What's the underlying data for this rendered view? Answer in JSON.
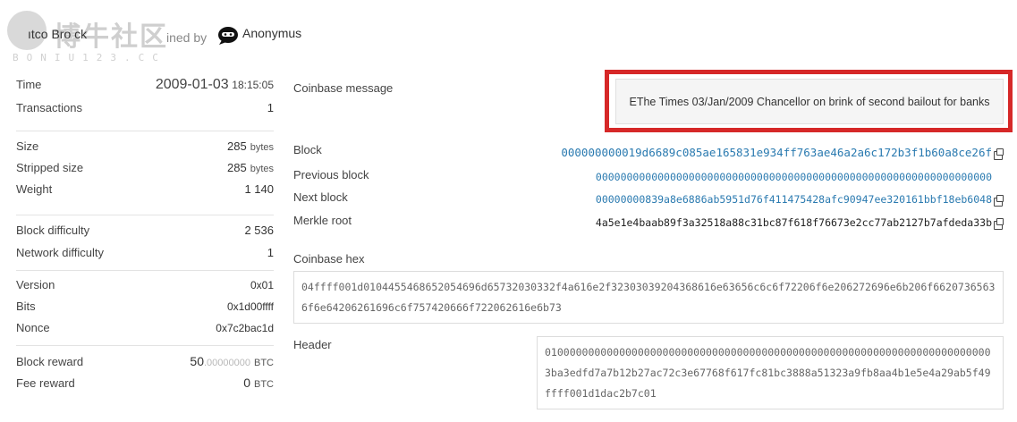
{
  "header": {
    "watermark_title": "博牛社区",
    "watermark_sub": "BONIU123.CC",
    "title_prefix": "ıtco Bro ck",
    "mined_by": "ined by",
    "miner": "Anonymus"
  },
  "left": {
    "group1": [
      {
        "label": "Time",
        "date": "2009-01-03",
        "time": "18:15:05"
      },
      {
        "label": "Transactions",
        "value": "1"
      }
    ],
    "group2": [
      {
        "label": "Size",
        "value": "285",
        "unit": "bytes"
      },
      {
        "label": "Stripped size",
        "value": "285",
        "unit": "bytes"
      },
      {
        "label": "Weight",
        "value": "1 140"
      }
    ],
    "group3": [
      {
        "label": "Block difficulty",
        "value": "2 536"
      },
      {
        "label": "Network difficulty",
        "value": "1"
      }
    ],
    "group4": [
      {
        "label": "Version",
        "value": "0x01"
      },
      {
        "label": "Bits",
        "value": "0x1d00ffff"
      },
      {
        "label": "Nonce",
        "value": "0x7c2bac1d"
      }
    ],
    "group5": [
      {
        "label": "Block reward",
        "value_int": "50",
        "value_dec": ".00000000",
        "unit": "BTC"
      },
      {
        "label": "Fee reward",
        "value": "0",
        "unit": "BTC"
      }
    ]
  },
  "right": {
    "coinbase_message_label": "Coinbase message",
    "coinbase_message": "EThe Times 03/Jan/2009 Chancellor on brink of second bailout for banks",
    "block_label": "Block",
    "block_hash": "000000000019d6689c085ae165831e934ff763ae46a2a6c172b3f1b60a8ce26f",
    "previous_label": "Previous block",
    "previous_hash": "0000000000000000000000000000000000000000000000000000000000000000",
    "next_label": "Next block",
    "next_hash": "00000000839a8e6886ab5951d76f411475428afc90947ee320161bbf18eb6048",
    "merkle_label": "Merkle root",
    "merkle_root": "4a5e1e4baab89f3a32518a88c31bc87f618f76673e2cc77ab2127b7afdeda33b",
    "coinbase_hex_label": "Coinbase hex",
    "coinbase_hex": "04ffff001d0104455468652054696d65732030332f4a616e2f32303039204368616e63656c6c6f72206f6e206272696e6b206f66207365636f6e64206261696c6f757420666f722062616e6b73",
    "header_label": "Header",
    "header_hex": "0100000000000000000000000000000000000000000000000000000000000000000000003ba3edfd7a7b12b27ac72c3e67768f617fc81bc3888a51323a9fb8aa4b1e5e4a29ab5f49ffff001d1dac2b7c01"
  },
  "colors": {
    "link": "#2a7ab0",
    "highlight_border": "#d62828"
  }
}
